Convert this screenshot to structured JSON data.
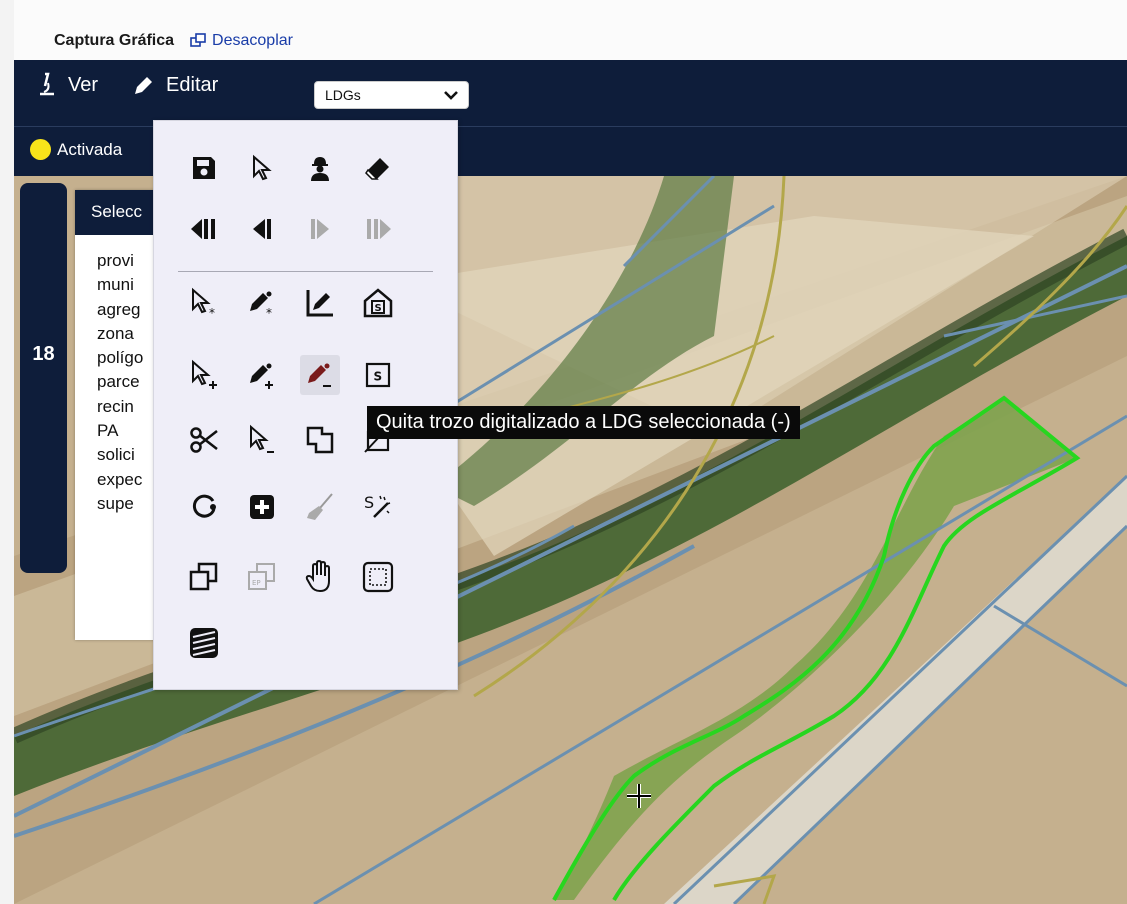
{
  "header": {
    "title": "Captura Gráfica",
    "decouple_label": "Desacoplar"
  },
  "toolbar": {
    "view_label": "Ver",
    "edit_label": "Editar",
    "layer_select": {
      "value": "LDGs"
    }
  },
  "status": {
    "label": "Activada",
    "dot_color": "#f8e41a"
  },
  "side_tab": {
    "number": "18"
  },
  "selection_panel": {
    "title": "Selecc",
    "fields": [
      "provi",
      "muni",
      "agreg",
      "zona",
      "polígo",
      "parce",
      "recin",
      "PA",
      "solici",
      "expec",
      "supe"
    ]
  },
  "edit_menu": {
    "icons": [
      "save-icon",
      "pointer-icon",
      "worker-icon",
      "eraser-icon",
      "go-first-icon",
      "step-back-icon",
      "step-forward-icon",
      "go-last-icon",
      "select-star-icon",
      "pencil-star-icon",
      "edit-line-icon",
      "building-s-icon",
      "select-plus-icon",
      "pencil-plus-icon",
      "pencil-minus-icon",
      "square-s-icon",
      "scissors-icon",
      "select-minus-icon",
      "merge-icon",
      "erase-shape-icon",
      "rotate-icon",
      "add-square-icon",
      "brush-icon",
      "magic-s-icon",
      "copy-icon",
      "copy-disabled-icon",
      "hand-icon",
      "dashed-box-icon",
      "stripes-icon"
    ]
  },
  "tooltip": {
    "text": "Quita trozo digitalizado a LDG seleccionada (-)"
  }
}
